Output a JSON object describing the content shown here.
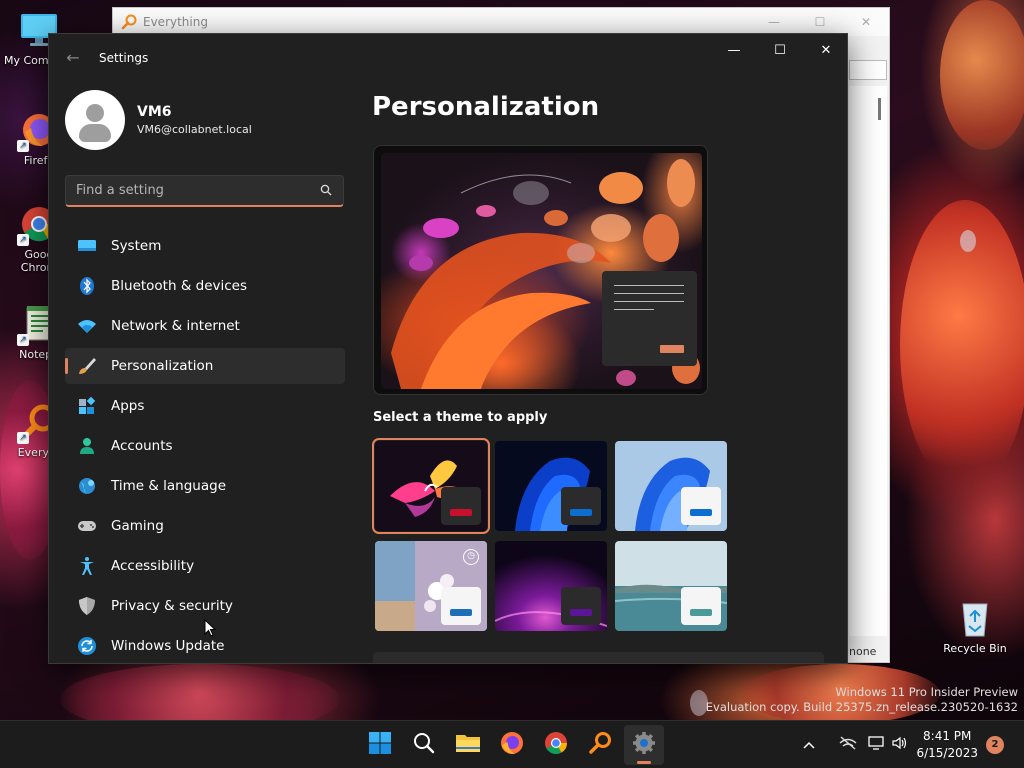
{
  "desktop": {
    "icons": [
      {
        "label": "My Com",
        "icon": "monitor-icon"
      },
      {
        "label": "Firefo",
        "icon": "firefox-icon"
      },
      {
        "label": "Goog\nChrom",
        "icon": "chrome-icon"
      },
      {
        "label": "Notepa",
        "icon": "notepad-icon"
      },
      {
        "label": "Everyth",
        "icon": "everything-icon"
      }
    ],
    "recycle_bin_label": "Recycle Bin",
    "watermark": {
      "line1": "Windows 11 Pro Insider Preview",
      "line2": "Evaluation copy. Build 25375.zn_release.230520-1632"
    }
  },
  "everything_window": {
    "title": "Everything",
    "status_text": "none",
    "controls": [
      "—",
      "☐",
      "✕"
    ]
  },
  "settings": {
    "window_title": "Settings",
    "back_glyph": "←",
    "controls": {
      "minimize": "—",
      "maximize": "☐",
      "close": "✕"
    },
    "profile": {
      "name": "VM6",
      "email": "VM6@collabnet.local"
    },
    "search": {
      "placeholder": "Find a setting"
    },
    "nav": [
      {
        "label": "System",
        "icon": "system-icon"
      },
      {
        "label": "Bluetooth & devices",
        "icon": "bluetooth-icon"
      },
      {
        "label": "Network & internet",
        "icon": "wifi-icon"
      },
      {
        "label": "Personalization",
        "icon": "brush-icon",
        "active": true
      },
      {
        "label": "Apps",
        "icon": "apps-icon"
      },
      {
        "label": "Accounts",
        "icon": "accounts-icon"
      },
      {
        "label": "Time & language",
        "icon": "globe-icon"
      },
      {
        "label": "Gaming",
        "icon": "gamepad-icon"
      },
      {
        "label": "Accessibility",
        "icon": "accessibility-icon"
      },
      {
        "label": "Privacy & security",
        "icon": "shield-icon"
      },
      {
        "label": "Windows Update",
        "icon": "update-icon"
      }
    ],
    "page_title": "Personalization",
    "theme_section_label": "Select a theme to apply",
    "themes": [
      {
        "name": "theme-glow",
        "selected": true,
        "accent": "#c8102e"
      },
      {
        "name": "theme-dark-bloom",
        "accent": "#0a6fd1"
      },
      {
        "name": "theme-light-bloom",
        "accent": "#0a6fd1"
      },
      {
        "name": "theme-captured-motion",
        "accent": "#1d6fb8",
        "badge": "slideshow"
      },
      {
        "name": "theme-flow",
        "accent": "#5b1596"
      },
      {
        "name": "theme-sunrise",
        "accent": "#4a9a9a"
      }
    ],
    "accent_color": "#e0845f"
  },
  "taskbar": {
    "apps": [
      "start-icon",
      "search-icon",
      "file-explorer-icon",
      "firefox-icon",
      "chrome-icon",
      "everything-icon",
      "settings-icon"
    ],
    "active_app": "settings-icon",
    "time": "8:41 PM",
    "date": "6/15/2023",
    "notification_count": "2"
  }
}
